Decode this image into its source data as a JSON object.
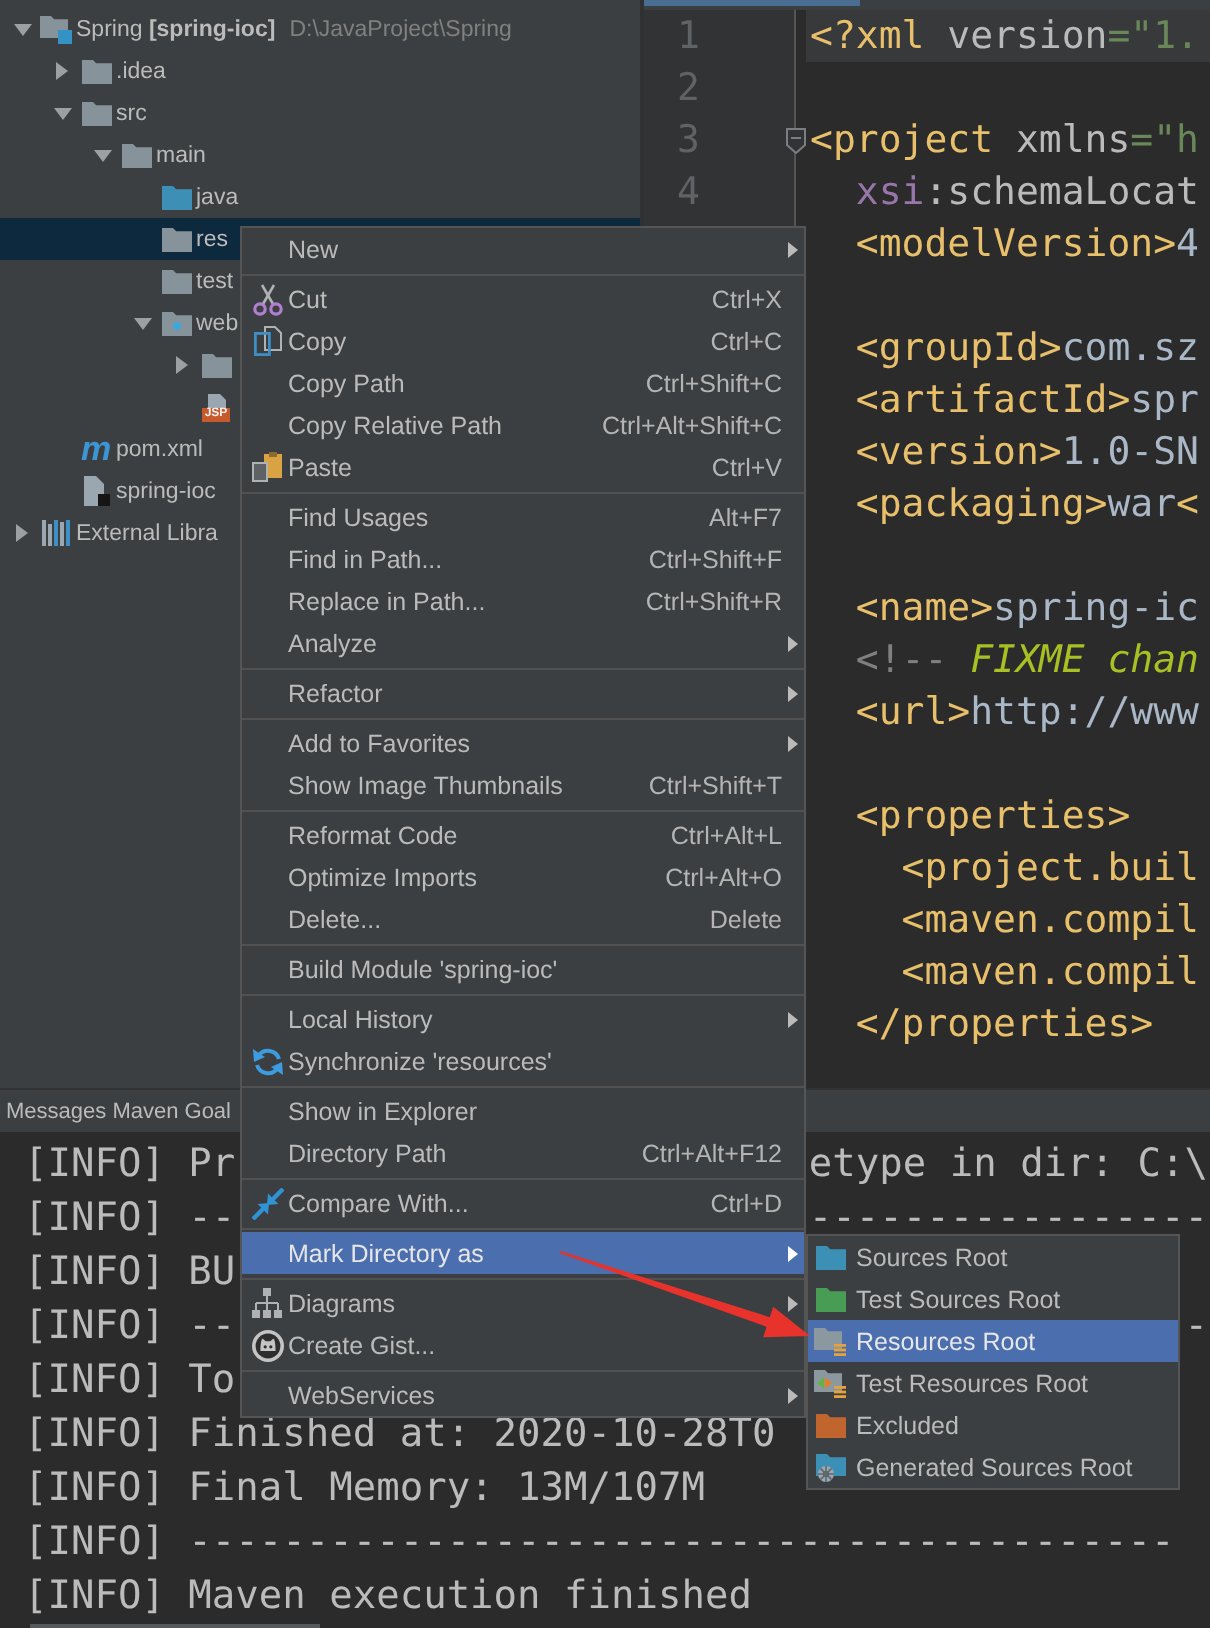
{
  "project_tree": {
    "items": [
      {
        "kind": "module",
        "label": "Spring **[spring-ioc]**",
        "detail": "D:\\JavaProject\\Spring",
        "expanded": true,
        "selected": false,
        "children": [
          {
            "kind": "folder",
            "label": ".idea",
            "expanded": false,
            "selected": false
          },
          {
            "kind": "folder",
            "label": "src",
            "expanded": true,
            "selected": false,
            "children": [
              {
                "kind": "folder",
                "label": "main",
                "expanded": true,
                "selected": false,
                "children": [
                  {
                    "kind": "sources",
                    "label": "java",
                    "selected": false
                  },
                  {
                    "kind": "folder",
                    "label": "res",
                    "selected": true
                  },
                  {
                    "kind": "folder",
                    "label": "test",
                    "selected": false
                  },
                  {
                    "kind": "web",
                    "label": "web",
                    "expanded": true,
                    "selected": false,
                    "children": [
                      {
                        "kind": "folder",
                        "expanded": false,
                        "selected": false
                      },
                      {
                        "kind": "jsp",
                        "badge": "JSP",
                        "selected": false
                      }
                    ]
                  }
                ]
              }
            ]
          },
          {
            "kind": "maven",
            "badge": "m",
            "label": "pom.xml",
            "selected": false
          },
          {
            "kind": "file",
            "label": "spring-ioc",
            "selected": false
          }
        ]
      },
      {
        "kind": "libraries",
        "label": "External Libra",
        "expanded": false,
        "selected": false
      }
    ]
  },
  "editor": {
    "lines": [
      {
        "kind": "code",
        "number": "1",
        "current": true,
        "fold": false,
        "tokens": [
          {
            "kind": "tag",
            "text": "<?xml "
          },
          {
            "kind": "attr",
            "text": "version"
          },
          {
            "kind": "value",
            "text": "=\"1."
          }
        ]
      },
      {
        "kind": "blank",
        "number": "2",
        "current": false,
        "fold": false
      },
      {
        "kind": "code",
        "number": "3",
        "current": false,
        "fold": true,
        "tokens": [
          {
            "kind": "tag",
            "text": "<project "
          },
          {
            "kind": "attr",
            "text": "xmlns"
          },
          {
            "kind": "value",
            "text": "=\"h"
          }
        ]
      },
      {
        "kind": "code",
        "number": "4",
        "current": false,
        "fold": false,
        "tokens": [
          {
            "kind": "ns",
            "text": "  xsi"
          },
          {
            "kind": "attr",
            "text": ":schemaLocat"
          }
        ]
      },
      {
        "kind": "code",
        "current": false,
        "fold": false,
        "tokens": [
          {
            "kind": "tag",
            "text": "  <modelVersion>"
          },
          {
            "kind": "text",
            "text": "4"
          }
        ]
      },
      {
        "kind": "blank",
        "current": false,
        "fold": false
      },
      {
        "kind": "code",
        "current": false,
        "fold": false,
        "tokens": [
          {
            "kind": "tag",
            "text": "  <groupId>"
          },
          {
            "kind": "text",
            "text": "com.sz"
          }
        ]
      },
      {
        "kind": "code",
        "current": false,
        "fold": false,
        "tokens": [
          {
            "kind": "tag",
            "text": "  <artifactId>"
          },
          {
            "kind": "text",
            "text": "spr"
          }
        ]
      },
      {
        "kind": "code",
        "current": false,
        "fold": false,
        "tokens": [
          {
            "kind": "tag",
            "text": "  <version>"
          },
          {
            "kind": "text",
            "text": "1.0-SN"
          }
        ]
      },
      {
        "kind": "code",
        "current": false,
        "fold": false,
        "tokens": [
          {
            "kind": "tag",
            "text": "  <packaging>"
          },
          {
            "kind": "text",
            "text": "war"
          },
          {
            "kind": "tag",
            "text": "<"
          }
        ]
      },
      {
        "kind": "blank",
        "current": false,
        "fold": false
      },
      {
        "kind": "code",
        "current": false,
        "fold": false,
        "tokens": [
          {
            "kind": "tag",
            "text": "  <name>"
          },
          {
            "kind": "text",
            "text": "spring-ic"
          }
        ]
      },
      {
        "kind": "code",
        "current": false,
        "fold": false,
        "tokens": [
          {
            "kind": "comment",
            "text": "  <!-- "
          },
          {
            "kind": "todo",
            "text": "FIXME chan"
          }
        ]
      },
      {
        "kind": "code",
        "current": false,
        "fold": false,
        "tokens": [
          {
            "kind": "tag",
            "text": "  <url>"
          },
          {
            "kind": "text",
            "text": "http://www"
          }
        ]
      },
      {
        "kind": "blank",
        "current": false,
        "fold": false
      },
      {
        "kind": "code",
        "current": false,
        "fold": false,
        "tokens": [
          {
            "kind": "tag",
            "text": "  <properties>"
          }
        ]
      },
      {
        "kind": "code",
        "current": false,
        "fold": false,
        "tokens": [
          {
            "kind": "tag",
            "text": "    <project.buil"
          }
        ]
      },
      {
        "kind": "code",
        "current": false,
        "fold": false,
        "tokens": [
          {
            "kind": "tag",
            "text": "    <maven.compil"
          }
        ]
      },
      {
        "kind": "code",
        "current": false,
        "fold": false,
        "tokens": [
          {
            "kind": "tag",
            "text": "    <maven.compil"
          }
        ]
      },
      {
        "kind": "code",
        "current": false,
        "fold": false,
        "tokens": [
          {
            "kind": "tag",
            "text": "  </properties>"
          }
        ]
      }
    ]
  },
  "tool_window": {
    "title": "Messages Maven Goal"
  },
  "console": {
    "lines": [
      {
        "text": "[INFO] Pr",
        "tail": "etype in dir: C:\\"
      },
      {
        "text": "[INFO] --",
        "tail": "-----------------"
      },
      {
        "text": "[INFO] BU"
      },
      {
        "text": "[INFO] --",
        "tail": "-"
      },
      {
        "text": "[INFO] To"
      },
      {
        "text": "[INFO] Finished at: 2020-10-28T0"
      },
      {
        "text": "[INFO] Final Memory: 13M/107M"
      },
      {
        "text": "[INFO] ------------------------------------------"
      },
      {
        "text": "[INFO] Maven execution finished"
      }
    ]
  },
  "context_menu": {
    "groups": [
      {
        "items": [
          {
            "label": "New",
            "kind": "plain",
            "submenu": true,
            "selected": false
          }
        ]
      },
      {
        "items": [
          {
            "label": "Cut",
            "kind": "cut",
            "shortcut": "Ctrl+X",
            "submenu": false,
            "selected": false
          },
          {
            "label": "Copy",
            "kind": "copy",
            "shortcut": "Ctrl+C",
            "submenu": false,
            "selected": false
          },
          {
            "label": "Copy Path",
            "kind": "plain",
            "shortcut": "Ctrl+Shift+C",
            "submenu": false,
            "selected": false
          },
          {
            "label": "Copy Relative Path",
            "kind": "plain",
            "shortcut": "Ctrl+Alt+Shift+C",
            "submenu": false,
            "selected": false
          },
          {
            "label": "Paste",
            "kind": "paste",
            "shortcut": "Ctrl+V",
            "submenu": false,
            "selected": false
          }
        ]
      },
      {
        "items": [
          {
            "label": "Find Usages",
            "kind": "plain",
            "shortcut": "Alt+F7",
            "submenu": false,
            "selected": false
          },
          {
            "label": "Find in Path...",
            "kind": "plain",
            "shortcut": "Ctrl+Shift+F",
            "submenu": false,
            "selected": false
          },
          {
            "label": "Replace in Path...",
            "kind": "plain",
            "shortcut": "Ctrl+Shift+R",
            "submenu": false,
            "selected": false
          },
          {
            "label": "Analyze",
            "kind": "plain",
            "submenu": true,
            "selected": false
          }
        ]
      },
      {
        "items": [
          {
            "label": "Refactor",
            "kind": "plain",
            "submenu": true,
            "selected": false
          }
        ]
      },
      {
        "items": [
          {
            "label": "Add to Favorites",
            "kind": "plain",
            "submenu": true,
            "selected": false
          },
          {
            "label": "Show Image Thumbnails",
            "kind": "plain",
            "shortcut": "Ctrl+Shift+T",
            "submenu": false,
            "selected": false
          }
        ]
      },
      {
        "items": [
          {
            "label": "Reformat Code",
            "kind": "plain",
            "shortcut": "Ctrl+Alt+L",
            "submenu": false,
            "selected": false
          },
          {
            "label": "Optimize Imports",
            "kind": "plain",
            "shortcut": "Ctrl+Alt+O",
            "submenu": false,
            "selected": false
          },
          {
            "label": "Delete...",
            "kind": "plain",
            "shortcut": "Delete",
            "submenu": false,
            "selected": false
          }
        ]
      },
      {
        "items": [
          {
            "label": "Build Module 'spring-ioc'",
            "kind": "plain",
            "submenu": false,
            "selected": false
          }
        ]
      },
      {
        "items": [
          {
            "label": "Local History",
            "kind": "plain",
            "submenu": true,
            "selected": false
          },
          {
            "label": "Synchronize 'resources'",
            "kind": "sync",
            "submenu": false,
            "selected": false
          }
        ]
      },
      {
        "items": [
          {
            "label": "Show in Explorer",
            "kind": "plain",
            "submenu": false,
            "selected": false
          },
          {
            "label": "Directory Path",
            "kind": "plain",
            "shortcut": "Ctrl+Alt+F12",
            "submenu": false,
            "selected": false
          }
        ]
      },
      {
        "items": [
          {
            "label": "Compare With...",
            "kind": "compare",
            "shortcut": "Ctrl+D",
            "submenu": false,
            "selected": false
          }
        ]
      },
      {
        "items": [
          {
            "label": "Mark Directory as",
            "kind": "plain",
            "submenu": true,
            "selected": true
          }
        ]
      },
      {
        "items": [
          {
            "label": "Diagrams",
            "kind": "diagram",
            "submenu": true,
            "selected": false
          },
          {
            "label": "Create Gist...",
            "kind": "gist",
            "submenu": false,
            "selected": false
          }
        ]
      },
      {
        "items": [
          {
            "label": "WebServices",
            "kind": "plain",
            "submenu": true,
            "selected": false
          }
        ]
      }
    ]
  },
  "mark_directory_submenu": {
    "items": [
      {
        "label": "Sources Root",
        "kind": "sources",
        "selected": false
      },
      {
        "label": "Test Sources Root",
        "kind": "testsources",
        "selected": false
      },
      {
        "label": "Resources Root",
        "kind": "resources",
        "selected": true
      },
      {
        "label": "Test Resources Root",
        "kind": "testresources",
        "selected": false
      },
      {
        "label": "Excluded",
        "kind": "excluded",
        "selected": false
      },
      {
        "label": "Generated Sources Root",
        "kind": "generated",
        "selected": false
      }
    ]
  }
}
